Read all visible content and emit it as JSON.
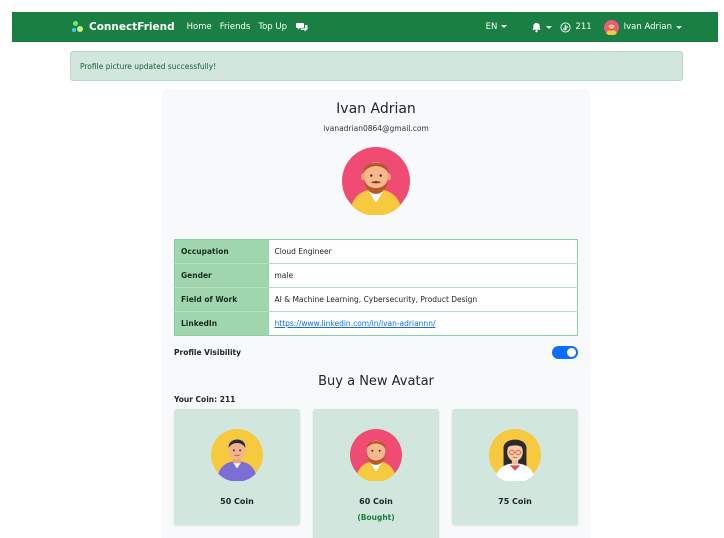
{
  "navbar": {
    "brand": "ConnectFriend",
    "links": [
      "Home",
      "Friends",
      "Top Up"
    ],
    "language": "EN",
    "coins": "211",
    "user_name": "Ivan Adrian",
    "icons": [
      "chat-icon",
      "bell-icon",
      "coin-icon"
    ],
    "bg_color": "#1a7f43"
  },
  "alert": {
    "message": "Profile picture updated successfully!"
  },
  "profile": {
    "name": "Ivan Adrian",
    "email": "ivanadrian0864@gmail.com",
    "details": [
      {
        "label": "Occupation",
        "value": "Cloud Engineer"
      },
      {
        "label": "Gender",
        "value": "male"
      },
      {
        "label": "Field of Work",
        "value": "AI & Machine Learning, Cybersecurity, Product Design"
      },
      {
        "label": "LinkedIn",
        "value": "https://www.linkedin.com/in/ivan-adriannn/"
      }
    ],
    "visibility_label": "Profile Visibility",
    "visibility_on": true
  },
  "shop": {
    "title": "Buy a New Avatar",
    "your_coin": "Your Coin: 211",
    "items": [
      {
        "price": "50 Coin",
        "status": ""
      },
      {
        "price": "60 Coin",
        "status": "(Bought)"
      },
      {
        "price": "75 Coin",
        "status": ""
      }
    ]
  }
}
